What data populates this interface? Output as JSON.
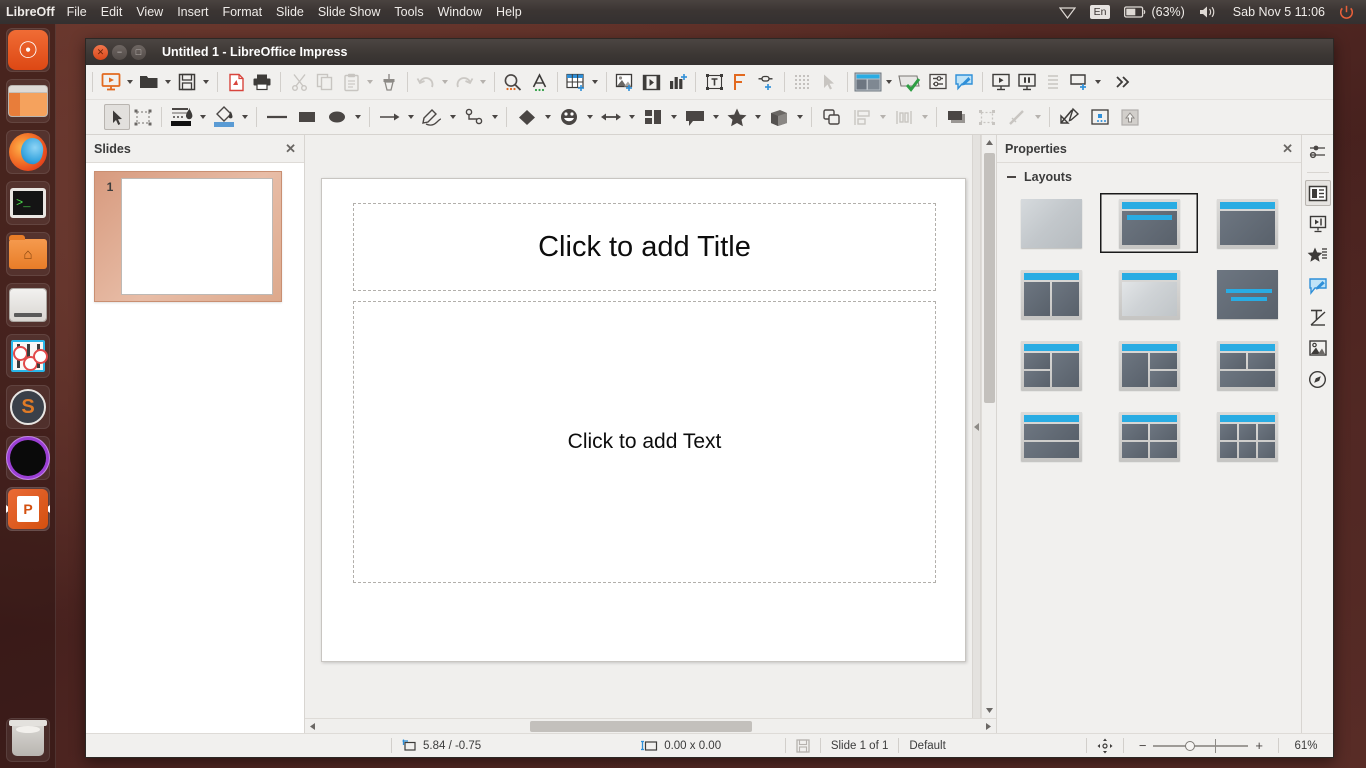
{
  "top_panel": {
    "menus": [
      {
        "label": "LibreOff",
        "name": "app-name"
      },
      {
        "label": "File",
        "name": "menu-file"
      },
      {
        "label": "Edit",
        "name": "menu-edit"
      },
      {
        "label": "View",
        "name": "menu-view"
      },
      {
        "label": "Insert",
        "name": "menu-insert"
      },
      {
        "label": "Format",
        "name": "menu-format"
      },
      {
        "label": "Slide",
        "name": "menu-slide"
      },
      {
        "label": "Slide Show",
        "name": "menu-slide-show"
      },
      {
        "label": "Tools",
        "name": "menu-tools"
      },
      {
        "label": "Window",
        "name": "menu-window"
      },
      {
        "label": "Help",
        "name": "menu-help"
      }
    ],
    "indicators": {
      "network_icon": "wifi-icon",
      "keyboard_layout": "En",
      "battery_icon": "battery-icon",
      "battery_percent": "(63%)",
      "volume_icon": "volume-icon",
      "clock": "Sab Nov 5   11:06",
      "power_icon": "power-icon"
    }
  },
  "launcher": {
    "items": [
      {
        "name": "ubuntu-dash-icon",
        "label": "Ubuntu Dash"
      },
      {
        "name": "files-app-icon",
        "label": "Files"
      },
      {
        "name": "firefox-icon",
        "label": "Firefox"
      },
      {
        "name": "terminal-icon",
        "label": "Terminal"
      },
      {
        "name": "home-folder-icon",
        "label": "Home Folder"
      },
      {
        "name": "disk-drive-icon",
        "label": "Disk"
      },
      {
        "name": "audio-mixer-icon",
        "label": "Audio Mixer"
      },
      {
        "name": "sublime-icon",
        "label": "Sublime"
      },
      {
        "name": "dark-circle-icon",
        "label": "Application"
      },
      {
        "name": "impress-icon",
        "label": "LibreOffice Impress"
      },
      {
        "name": "trash-icon",
        "label": "Trash"
      }
    ]
  },
  "window": {
    "title": "Untitled 1 - LibreOffice Impress",
    "buttons": {
      "close": "close-button",
      "minimize": "minimize-button",
      "maximize": "maximize-button"
    }
  },
  "toolbar_main": [
    {
      "name": "new-presentation-button",
      "icon": "presentation-icon",
      "dropdown": true
    },
    {
      "name": "open-button",
      "icon": "folder-open-icon",
      "dropdown": true
    },
    {
      "name": "save-button",
      "icon": "floppy-save-icon",
      "dropdown": true
    },
    {
      "name": "export-pdf-button",
      "icon": "pdf-icon"
    },
    {
      "name": "print-button",
      "icon": "printer-icon"
    },
    {
      "name": "cut-button",
      "icon": "scissors-icon"
    },
    {
      "name": "copy-button",
      "icon": "copy-icon"
    },
    {
      "name": "paste-button",
      "icon": "clipboard-icon",
      "dropdown": true
    },
    {
      "name": "clone-formatting-button",
      "icon": "paintbrush-icon"
    },
    {
      "name": "undo-button",
      "icon": "undo-arrow-icon",
      "dropdown": true
    },
    {
      "name": "redo-button",
      "icon": "redo-arrow-icon",
      "dropdown": true
    },
    {
      "name": "find-replace-button",
      "icon": "magnifier-icon"
    },
    {
      "name": "spelling-button",
      "icon": "spellcheck-abc-icon"
    },
    {
      "name": "insert-table-button",
      "icon": "table-icon",
      "dropdown": true
    },
    {
      "name": "insert-image-button",
      "icon": "image-icon"
    },
    {
      "name": "insert-media-button",
      "icon": "media-film-icon"
    },
    {
      "name": "insert-chart-button",
      "icon": "chart-icon"
    },
    {
      "name": "insert-textbox-button",
      "icon": "text-box-icon"
    },
    {
      "name": "insert-fontwork-button",
      "icon": "fontwork-f-icon"
    },
    {
      "name": "insert-hyperlink-button",
      "icon": "hyperlink-icon"
    },
    {
      "name": "show-grid-button",
      "icon": "grid-dots-icon"
    },
    {
      "name": "snap-to-grid-button",
      "icon": "cursor-arrow-icon"
    },
    {
      "name": "display-views-button",
      "icon": "master-slide-icon",
      "dropdown": true
    },
    {
      "name": "slide-properties-button",
      "icon": "slide-check-icon"
    },
    {
      "name": "master-slide-button",
      "icon": "master-settings-icon"
    },
    {
      "name": "start-from-first-slide-button",
      "icon": "comment-edit-icon"
    },
    {
      "name": "start-slideshow-button",
      "icon": "present-screen-icon"
    },
    {
      "name": "presenter-console-button",
      "icon": "present-pause-icon"
    },
    {
      "name": "outline-button",
      "icon": "outline-lines-icon"
    },
    {
      "name": "new-slide-button",
      "icon": "new-slide-icon",
      "dropdown": true
    },
    {
      "name": "toolbar-overflow-button",
      "icon": "chevron-double-right-icon"
    }
  ],
  "toolbar_drawing": [
    {
      "name": "select-tool-button",
      "icon": "cursor-arrow-icon",
      "selected": true
    },
    {
      "name": "rotate-tool-button",
      "icon": "rotate-handles-icon"
    },
    {
      "name": "line-color-button",
      "icon": "line-color-icon",
      "dropdown": true
    },
    {
      "name": "fill-color-button",
      "icon": "paint-bucket-icon",
      "dropdown": true
    },
    {
      "name": "insert-line-button",
      "icon": "line-icon"
    },
    {
      "name": "rectangle-button",
      "icon": "rectangle-icon"
    },
    {
      "name": "ellipse-button",
      "icon": "ellipse-icon"
    },
    {
      "name": "arrow-line-button",
      "icon": "arrow-line-icon",
      "dropdown": true
    },
    {
      "name": "curve-button",
      "icon": "freeform-pencil-icon",
      "dropdown": true
    },
    {
      "name": "connector-button",
      "icon": "connector-icon",
      "dropdown": true
    },
    {
      "name": "basic-shapes-button",
      "icon": "diamond-shape-icon",
      "dropdown": true
    },
    {
      "name": "symbol-shapes-button",
      "icon": "smiley-face-icon",
      "dropdown": true
    },
    {
      "name": "block-arrows-button",
      "icon": "double-arrow-icon",
      "dropdown": true
    },
    {
      "name": "flowchart-button",
      "icon": "flowchart-blocks-icon",
      "dropdown": true
    },
    {
      "name": "callouts-button",
      "icon": "speech-bubble-icon",
      "dropdown": true
    },
    {
      "name": "stars-button",
      "icon": "star-icon",
      "dropdown": true
    },
    {
      "name": "3d-objects-button",
      "icon": "cube-3d-icon",
      "dropdown": true
    },
    {
      "name": "arrange-button",
      "icon": "arrange-objects-icon"
    },
    {
      "name": "align-objects-button",
      "icon": "align-left-icon",
      "dropdown": true
    },
    {
      "name": "distribute-button",
      "icon": "distribute-icon",
      "dropdown": true
    },
    {
      "name": "select-at-least-two-button",
      "icon": "two-objects-icon"
    },
    {
      "name": "shadow-button",
      "icon": "shadow-rect-icon"
    },
    {
      "name": "crop-image-button",
      "icon": "crop-icon"
    },
    {
      "name": "filter-button",
      "icon": "magic-wand-icon",
      "dropdown": true
    },
    {
      "name": "points-edit-button",
      "icon": "edit-points-icon"
    },
    {
      "name": "glue-points-button",
      "icon": "glue-points-icon"
    },
    {
      "name": "to-foreground-button",
      "icon": "bring-forward-icon"
    }
  ],
  "slides_panel": {
    "title": "Slides",
    "close_icon": "close-icon",
    "slides": [
      {
        "number": "1",
        "name": "slide-thumbnail-1"
      }
    ]
  },
  "editor": {
    "title_placeholder": "Click to add Title",
    "text_placeholder": "Click to add Text"
  },
  "properties_panel": {
    "title": "Properties",
    "close_icon": "close-icon",
    "sections": [
      {
        "title": "Layouts",
        "collapsed": false,
        "layouts": [
          {
            "name": "layout-blank",
            "label": "Blank Slide",
            "type": "blank",
            "selected": false
          },
          {
            "name": "layout-title-content",
            "label": "Title, Content",
            "type": "title-content",
            "selected": true
          },
          {
            "name": "layout-title-only",
            "label": "Title Only",
            "type": "title-only",
            "selected": false
          },
          {
            "name": "layout-two-content",
            "label": "Title and 2 Content",
            "type": "two-content",
            "selected": false
          },
          {
            "name": "layout-title-slide",
            "label": "Title Slide",
            "type": "title-slide",
            "selected": false
          },
          {
            "name": "layout-centered-text",
            "label": "Centered Text",
            "type": "centered-text",
            "selected": false
          },
          {
            "name": "layout-two-content-left-split",
            "label": "Two Content and Content",
            "type": "left-split",
            "selected": false
          },
          {
            "name": "layout-content-two-right",
            "label": "Content and 2 Content",
            "type": "right-split",
            "selected": false
          },
          {
            "name": "layout-two-top-one-bottom",
            "label": "Two Content over Content",
            "type": "two-over-one",
            "selected": false
          },
          {
            "name": "layout-two-rows",
            "label": "Content over Content",
            "type": "two-rows",
            "selected": false
          },
          {
            "name": "layout-four-content",
            "label": "4 Content",
            "type": "four-content",
            "selected": false
          },
          {
            "name": "layout-six-content",
            "label": "6 Content",
            "type": "six-content",
            "selected": false
          }
        ]
      }
    ],
    "rail_tabs": [
      {
        "name": "sidebar-settings-icon",
        "label": "Sidebar Settings",
        "active": false
      },
      {
        "name": "properties-tab-icon",
        "label": "Properties",
        "active": true
      },
      {
        "name": "slide-transition-tab-icon",
        "label": "Slide Transition",
        "active": false
      },
      {
        "name": "animation-tab-icon",
        "label": "Animation",
        "active": false
      },
      {
        "name": "master-slides-tab-icon",
        "label": "Master Slides",
        "active": false
      },
      {
        "name": "styles-tab-icon",
        "label": "Styles",
        "active": false
      },
      {
        "name": "gallery-tab-icon",
        "label": "Gallery",
        "active": false
      },
      {
        "name": "navigator-tab-icon",
        "label": "Navigator",
        "active": false
      }
    ]
  },
  "statusbar": {
    "cursor_position": "5.84 / -0.75",
    "object_size": "0.00 x 0.00",
    "save_icon": "save-status-icon",
    "slide_info": "Slide 1 of 1",
    "master_name": "Default",
    "fit_slide_icon": "fit-slide-icon",
    "zoom_out": "−",
    "zoom_in": "+",
    "zoom_level": "61%"
  }
}
